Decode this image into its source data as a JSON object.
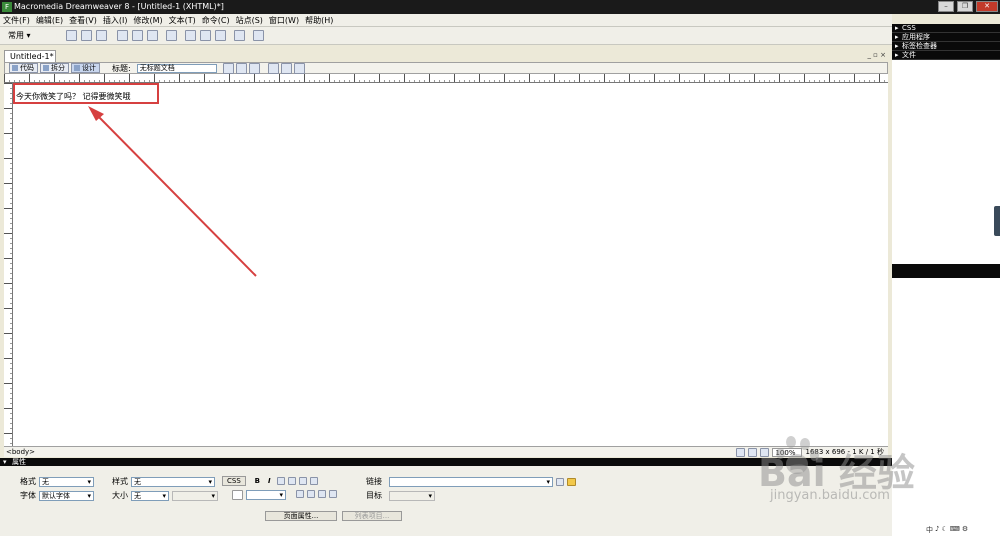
{
  "window": {
    "title": "Macromedia Dreamweaver 8 - [Untitled-1 (XHTML)*]",
    "app_icon": "F",
    "minimize": "–",
    "restore": "❐",
    "close": "✕"
  },
  "menu": {
    "items": [
      "文件(F)",
      "编辑(E)",
      "查看(V)",
      "插入(I)",
      "修改(M)",
      "文本(T)",
      "命令(C)",
      "站点(S)",
      "窗口(W)",
      "帮助(H)"
    ]
  },
  "insert_bar": {
    "category": "常用 ▾"
  },
  "document": {
    "tab_label": "Untitled-1*",
    "window_controls": "_ ▫ ×",
    "toolbar": {
      "code": "代码",
      "split": "拆分",
      "design": "设计",
      "title_label": "标题:",
      "title_value": "无标题文档"
    },
    "body_text": "今天你微笑了吗？ 记得要微笑哦",
    "status": {
      "tag": "<body>",
      "zoom": "100%",
      "size": "1683 x 696 - 1 K / 1 秒"
    }
  },
  "panels": {
    "items": [
      "CSS",
      "应用程序",
      "标签检查器",
      "文件"
    ]
  },
  "properties": {
    "header": "属性",
    "format_label": "格式",
    "format_value": "无",
    "style_label": "样式",
    "style_value": "无",
    "css_button": "CSS",
    "bold": "B",
    "italic": "I",
    "link_label": "链接",
    "font_label": "字体",
    "font_value": "默认字体",
    "size_label": "大小",
    "size_value": "无",
    "target_label": "目标",
    "page_props_button": "页面属性...",
    "list_item_button": "列表项目..."
  },
  "watermark": {
    "brand": "Bai 经验",
    "url": "jingyan.baidu.com"
  },
  "tray": {
    "icons": [
      "中",
      "♪",
      "☾",
      "⌨",
      "⚙"
    ]
  },
  "colors": {
    "annotation_red": "#d64040",
    "panel_black": "#0a0a0a"
  }
}
